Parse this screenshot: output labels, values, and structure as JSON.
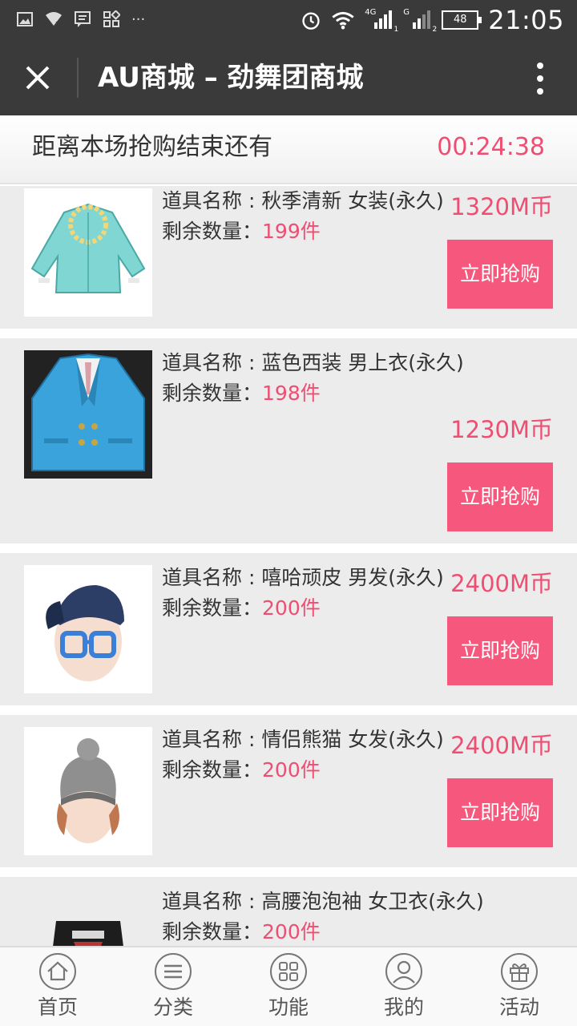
{
  "status_bar": {
    "time": "21:05",
    "battery": "48",
    "network_1": "4G",
    "network_2": "G",
    "sim1": "1",
    "sim2": "2",
    "more_dots": "···"
  },
  "header": {
    "title": "AU商城 – 劲舞团商城"
  },
  "countdown": {
    "label": "距离本场抢购结束还有",
    "time": "00:24:38"
  },
  "labels": {
    "name_prefix": "道具名称 : ",
    "stock_prefix": "剩余数量：",
    "buy": "立即抢购"
  },
  "items": [
    {
      "name": "秋季清新 女装(永久)",
      "stock": "199件",
      "price": "1320M币",
      "thumbnail": "teal-jacket"
    },
    {
      "name": "蓝色西装 男上衣(永久)",
      "stock": "198件",
      "price": "1230M币",
      "thumbnail": "blue-suit"
    },
    {
      "name": "嘻哈顽皮 男发(永久)",
      "stock": "200件",
      "price": "2400M币",
      "thumbnail": "cap-glasses"
    },
    {
      "name": "情侣熊猫 女发(永久)",
      "stock": "200件",
      "price": "2400M币",
      "thumbnail": "beanie"
    },
    {
      "name": "高腰泡泡袖 女卫衣(永久)",
      "stock": "200件",
      "price": "",
      "thumbnail": "black-hoodie"
    }
  ],
  "nav": [
    {
      "label": "首页",
      "icon": "home-icon"
    },
    {
      "label": "分类",
      "icon": "menu-icon"
    },
    {
      "label": "功能",
      "icon": "grid-icon"
    },
    {
      "label": "我的",
      "icon": "user-icon"
    },
    {
      "label": "活动",
      "icon": "gift-icon"
    }
  ],
  "colors": {
    "accent": "#ef4e72",
    "button": "#f6577c",
    "header_bg": "#3a3a3a",
    "card_bg": "#ececec"
  }
}
